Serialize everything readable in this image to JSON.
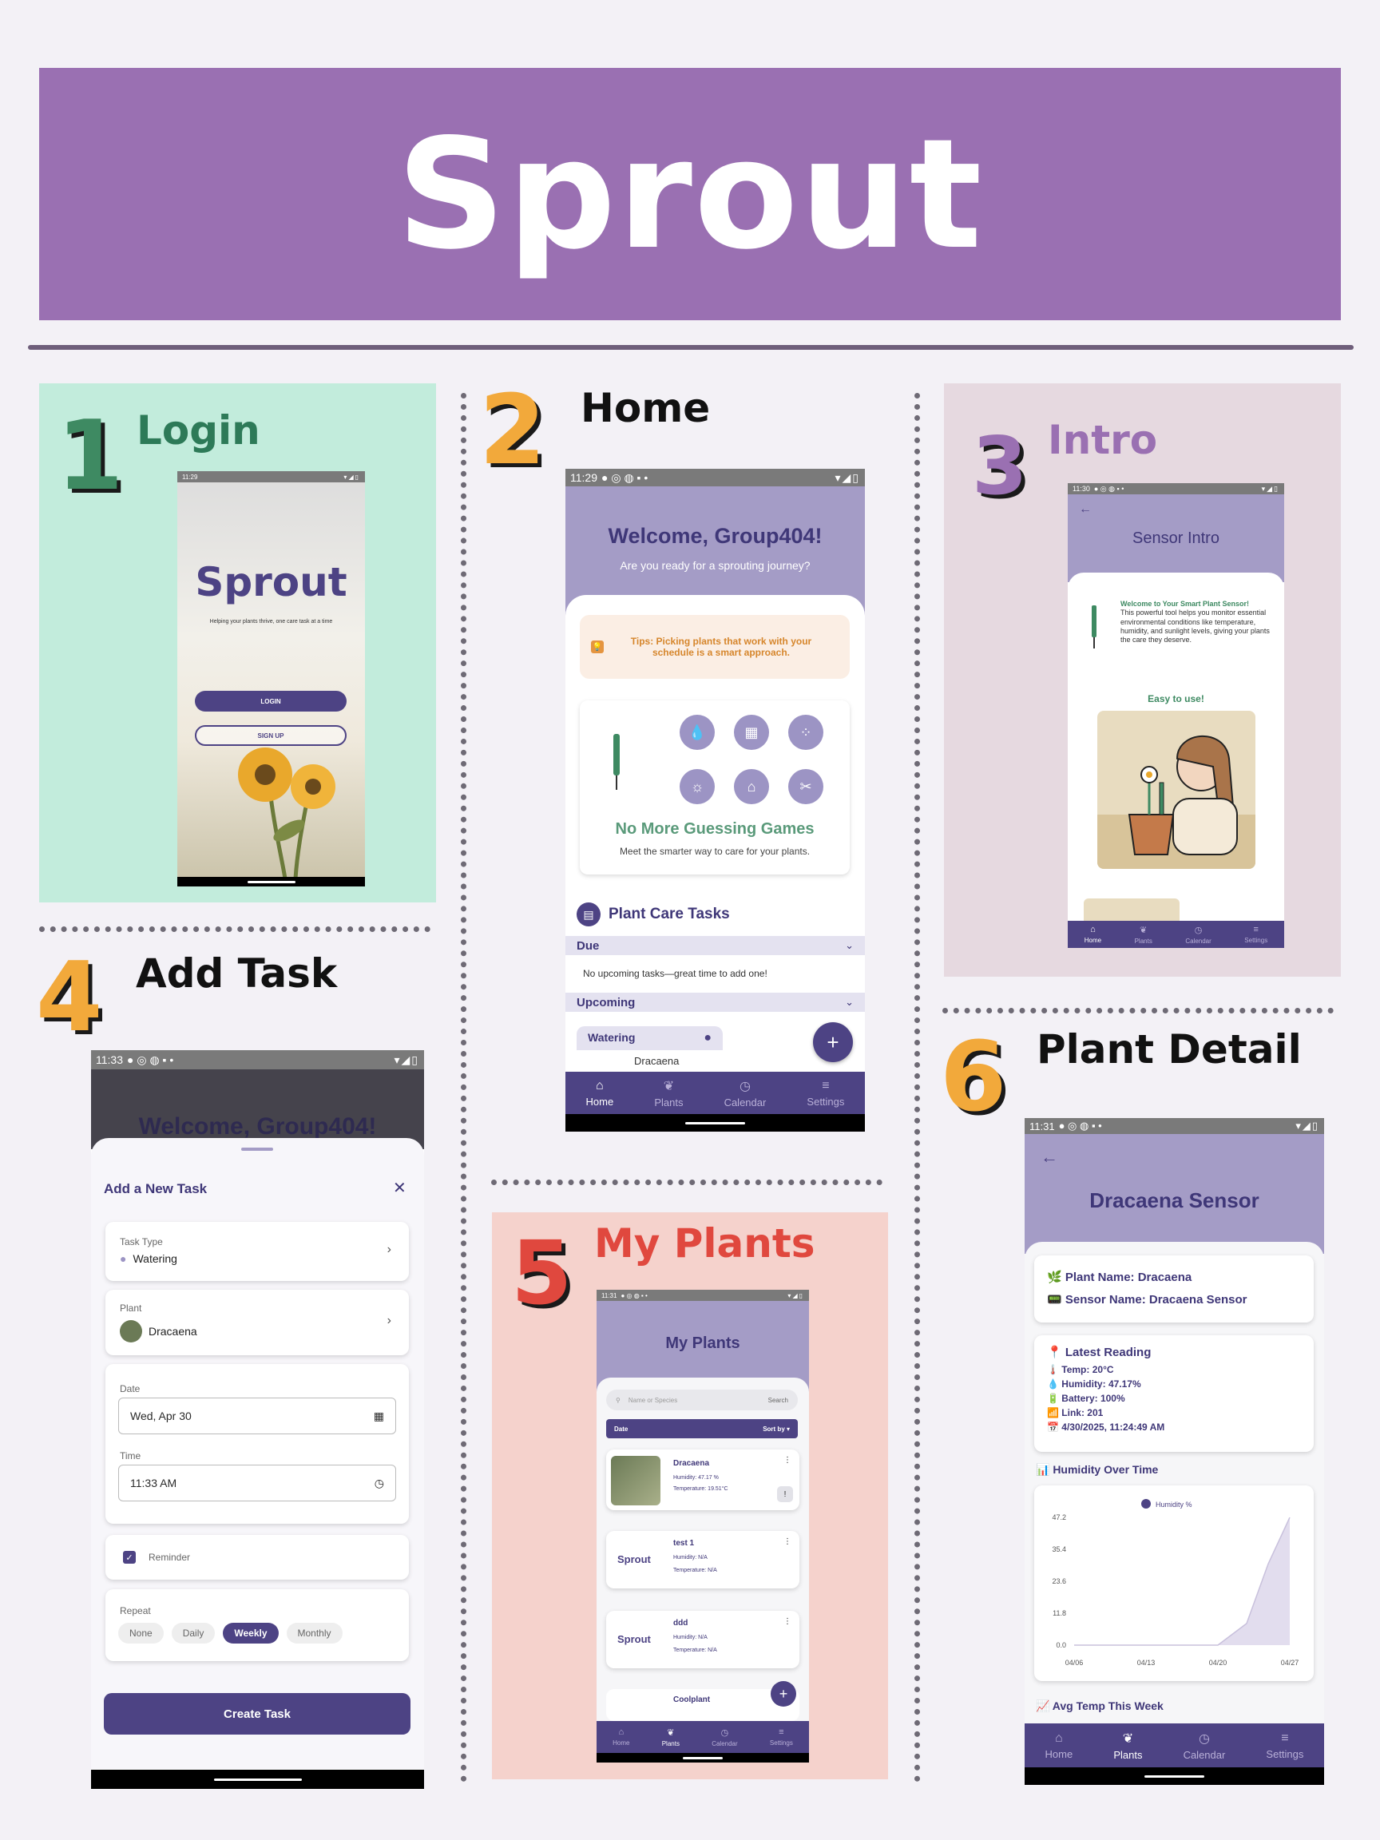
{
  "banner": {
    "title": "Sprout"
  },
  "sections": {
    "s1": {
      "num": "1",
      "title": "Login"
    },
    "s2": {
      "num": "2",
      "title": "Home"
    },
    "s3": {
      "num": "3",
      "title": "Intro"
    },
    "s4": {
      "num": "4",
      "title": "Add Task"
    },
    "s5": {
      "num": "5",
      "title": "My Plants"
    },
    "s6": {
      "num": "6",
      "title": "Plant Detail"
    }
  },
  "colors": {
    "banner": "#9a70b2",
    "primary": "#4d4384",
    "header": "#a49cc6",
    "login_bg": "#c2ecdc",
    "intro_bg": "#e6d9e0",
    "plants_bg": "#f5d2cc",
    "green": "#3e8a62"
  },
  "login": {
    "time": "11:29",
    "logo": "Sprout",
    "tagline": "Helping your plants thrive, one care task at a time",
    "login_btn": "LOGIN",
    "signup_btn": "SIGN UP"
  },
  "home": {
    "time": "11:29",
    "welcome": "Welcome, Group404!",
    "subtitle": "Are you ready for a sprouting journey?",
    "tip": "Tips: Picking plants that work with your schedule is a smart approach.",
    "promo_title": "No More Guessing Games",
    "promo_sub": "Meet the smarter way to care for your plants.",
    "tasks_title": "Plant Care Tasks",
    "due_label": "Due",
    "no_tasks": "No upcoming tasks—great time to add one!",
    "upcoming_label": "Upcoming",
    "task_card_title": "Watering",
    "task_card_plant": "Dracaena",
    "fab": "+"
  },
  "tabs": [
    "Home",
    "Plants",
    "Calendar",
    "Settings"
  ],
  "intro": {
    "time": "11:30",
    "title": "Sensor Intro",
    "welcome_bold": "Welcome to Your Smart Plant Sensor!",
    "welcome_text": "This powerful tool helps you monitor essential environmental conditions like temperature, humidity, and sunlight levels, giving your plants the care they deserve.",
    "easy": "Easy to use!"
  },
  "add_task": {
    "time": "11:33",
    "bg_welcome": "Welcome, Group404!",
    "sheet_title": "Add a New Task",
    "task_type_label": "Task Type",
    "task_type_value": "Watering",
    "plant_label": "Plant",
    "plant_value": "Dracaena",
    "date_label": "Date",
    "date_value": "Wed, Apr 30",
    "time_label": "Time",
    "time_value": "11:33 AM",
    "reminder_label": "Reminder",
    "repeat_label": "Repeat",
    "repeat_options": [
      "None",
      "Daily",
      "Weekly",
      "Monthly"
    ],
    "repeat_selected": "Weekly",
    "create_btn": "Create Task"
  },
  "my_plants": {
    "time": "11:31",
    "title": "My Plants",
    "search_placeholder": "Name or Species",
    "search_btn": "Search",
    "sort_date": "Date",
    "sort_by": "Sort by ▾",
    "plants": [
      {
        "name": "Dracaena",
        "humidity": "Humidity: 47.17 %",
        "temperature": "Temperature: 19.51°C",
        "thumb": "photo"
      },
      {
        "name": "test 1",
        "humidity": "Humidity: N/A",
        "temperature": "Temperature: N/A",
        "thumb": "Sprout"
      },
      {
        "name": "ddd",
        "humidity": "Humidity: N/A",
        "temperature": "Temperature: N/A",
        "thumb": "Sprout"
      }
    ],
    "next_plant": "Coolplant",
    "fab": "+"
  },
  "detail": {
    "time": "11:31",
    "title": "Dracaena Sensor",
    "plant_name": "🌿 Plant Name: Dracaena",
    "sensor_name": "📟 Sensor Name: Dracaena Sensor",
    "latest_title": "📍 Latest Reading",
    "temp": "🌡️ Temp: 20°C",
    "humidity": "💧 Humidity: 47.17%",
    "battery": "🔋 Battery: 100%",
    "link": "📶 Link: 201",
    "timestamp": "📅 4/30/2025, 11:24:49 AM",
    "humidity_over_time": "📊 Humidity Over Time",
    "avg_temp": "📈 Avg Temp This Week"
  },
  "chart_data": {
    "type": "area",
    "title": "",
    "legend": [
      "Humidity %"
    ],
    "x": [
      "04/06",
      "04/13",
      "04/20",
      "04/27"
    ],
    "yticks": [
      "0.0",
      "11.8",
      "23.6",
      "35.4",
      "47.2"
    ],
    "ylim": [
      0,
      47.2
    ],
    "series": [
      {
        "name": "Humidity %",
        "points": [
          [
            0,
            0
          ],
          [
            1,
            0
          ],
          [
            2,
            0
          ],
          [
            2.4,
            8
          ],
          [
            2.7,
            30
          ],
          [
            3,
            47.17
          ]
        ]
      }
    ],
    "xlabel": "",
    "ylabel": ""
  }
}
